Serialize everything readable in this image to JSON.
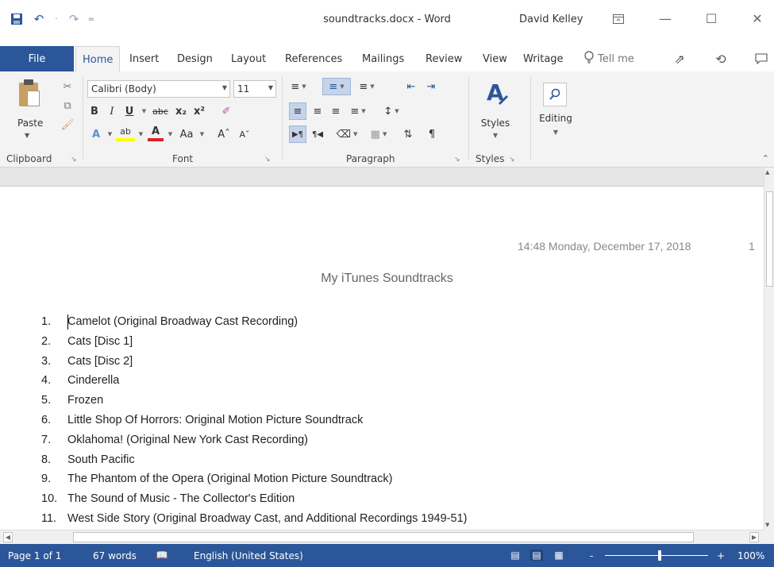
{
  "titlebar": {
    "document_title": "soundtracks.docx - Word",
    "user_name": "David Kelley",
    "qat_separator": "·",
    "qat_customize": "=",
    "minimize_glyph": "—",
    "maximize_glyph": "☐",
    "close_glyph": "✕"
  },
  "tabs": {
    "file": "File",
    "items": [
      "Home",
      "Insert",
      "Design",
      "Layout",
      "References",
      "Mailings",
      "Review",
      "View",
      "Writage"
    ],
    "active": "Home",
    "tell_me": "Tell me"
  },
  "ribbon": {
    "clipboard": {
      "label": "Clipboard",
      "paste": "Paste"
    },
    "font": {
      "label": "Font",
      "font_name": "Calibri (Body)",
      "font_size": "11",
      "bold": "B",
      "italic": "I",
      "underline": "U",
      "strikethrough": "abc",
      "subscript": "x₂",
      "superscript": "x²",
      "text_effects": "A",
      "highlight": "ab",
      "font_color": "A",
      "change_case": "Aa",
      "grow": "Aˆ",
      "shrink": "Aˇ"
    },
    "paragraph": {
      "label": "Paragraph"
    },
    "styles": {
      "label": "Styles",
      "button": "Styles"
    },
    "editing": {
      "button": "Editing"
    }
  },
  "document": {
    "header_date": "14:48 Monday, December 17, 2018",
    "header_page": "1",
    "title": "My iTunes Soundtracks",
    "tracks": [
      {
        "num": "1.",
        "text": "Camelot (Original Broadway Cast Recording)"
      },
      {
        "num": "2.",
        "text": "Cats [Disc 1]"
      },
      {
        "num": "3.",
        "text": "Cats [Disc 2]"
      },
      {
        "num": "4.",
        "text": "Cinderella"
      },
      {
        "num": "5.",
        "text": "Frozen"
      },
      {
        "num": "6.",
        "text": "Little Shop Of Horrors: Original Motion Picture Soundtrack"
      },
      {
        "num": "7.",
        "text": "Oklahoma! (Original New York Cast Recording)"
      },
      {
        "num": "8.",
        "text": "South Pacific"
      },
      {
        "num": "9.",
        "text": "The Phantom of the Opera (Original Motion Picture Soundtrack)"
      },
      {
        "num": "10.",
        "text": "The Sound of Music - The Collector's Edition"
      },
      {
        "num": "11.",
        "text": "West Side Story (Original Broadway Cast, and Additional Recordings 1949-51)"
      }
    ]
  },
  "statusbar": {
    "page": "Page 1 of 1",
    "words": "67 words",
    "language": "English (United States)",
    "zoom_minus": "-",
    "zoom_plus": "+",
    "zoom": "100%"
  },
  "colors": {
    "accent": "#2b579a",
    "ribbon_bg": "#f3f3f3",
    "status_bg": "#2b579a"
  }
}
